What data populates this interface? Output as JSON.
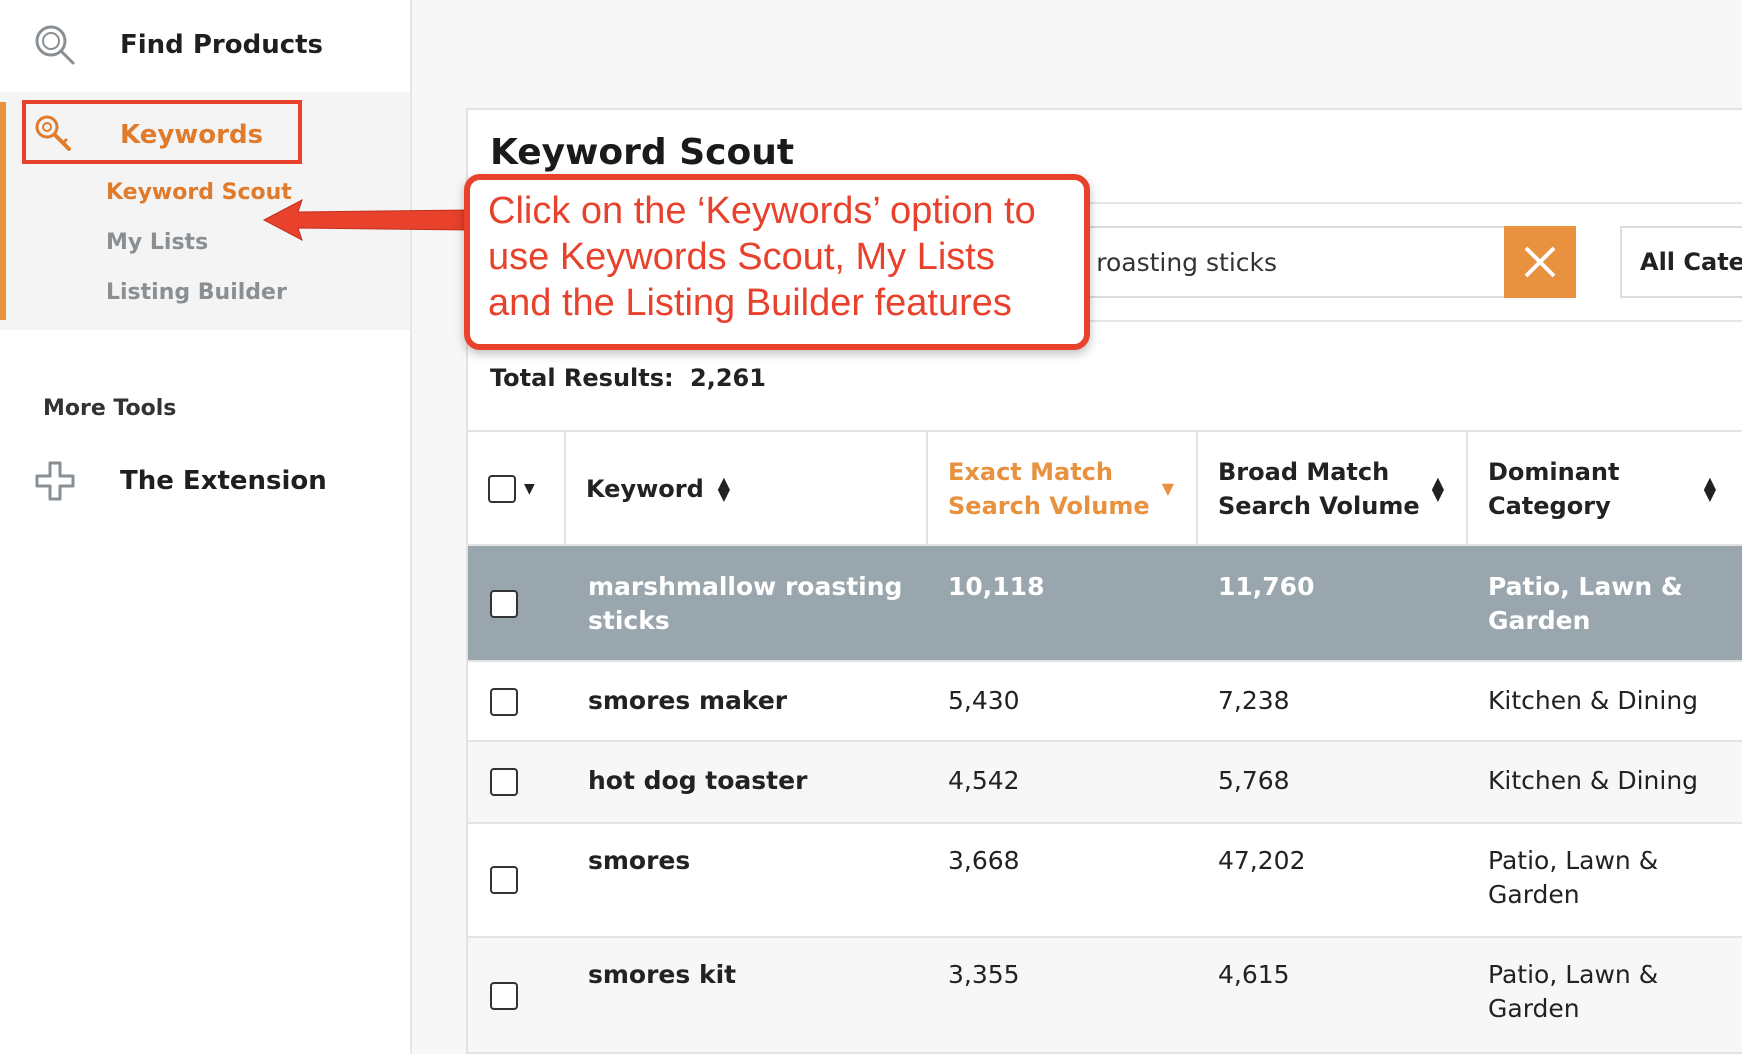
{
  "sidebar": {
    "find_products": "Find Products",
    "keywords": "Keywords",
    "sub_items": [
      "Keyword Scout",
      "My Lists",
      "Listing Builder"
    ],
    "more_tools": "More Tools",
    "extension": "The Extension"
  },
  "main": {
    "title": "Keyword Scout",
    "search_value": "r roasting sticks",
    "category": "All Categ",
    "total_label": "Total Results:",
    "total_value": "2,261"
  },
  "table": {
    "headers": {
      "keyword": "Keyword",
      "exact_l1": "Exact Match",
      "exact_l2": "Search Volume",
      "broad_l1": "Broad Match",
      "broad_l2": "Search Volume",
      "dom_l1": "Dominant",
      "dom_l2": "Category"
    },
    "rows": [
      {
        "kw1": "marshmallow roasting",
        "kw2": "sticks",
        "exact": "10,118",
        "broad": "11,760",
        "cat1": "Patio, Lawn &",
        "cat2": "Garden"
      },
      {
        "kw1": "smores maker",
        "kw2": "",
        "exact": "5,430",
        "broad": "7,238",
        "cat1": "Kitchen & Dining",
        "cat2": ""
      },
      {
        "kw1": "hot dog toaster",
        "kw2": "",
        "exact": "4,542",
        "broad": "5,768",
        "cat1": "Kitchen & Dining",
        "cat2": ""
      },
      {
        "kw1": "smores",
        "kw2": "",
        "exact": "3,668",
        "broad": "47,202",
        "cat1": "Patio, Lawn &",
        "cat2": "Garden"
      },
      {
        "kw1": "smores kit",
        "kw2": "",
        "exact": "3,355",
        "broad": "4,615",
        "cat1": "Patio, Lawn &",
        "cat2": "Garden"
      }
    ]
  },
  "annotation": {
    "line1": "Click on the ‘Keywords’ option to",
    "line2": "use Keywords Scout, My Lists",
    "line3": "and the Listing Builder features"
  },
  "colors": {
    "accent": "#e8913e",
    "annotation_red": "#e8412c",
    "selected_row": "#9aa6ae"
  }
}
